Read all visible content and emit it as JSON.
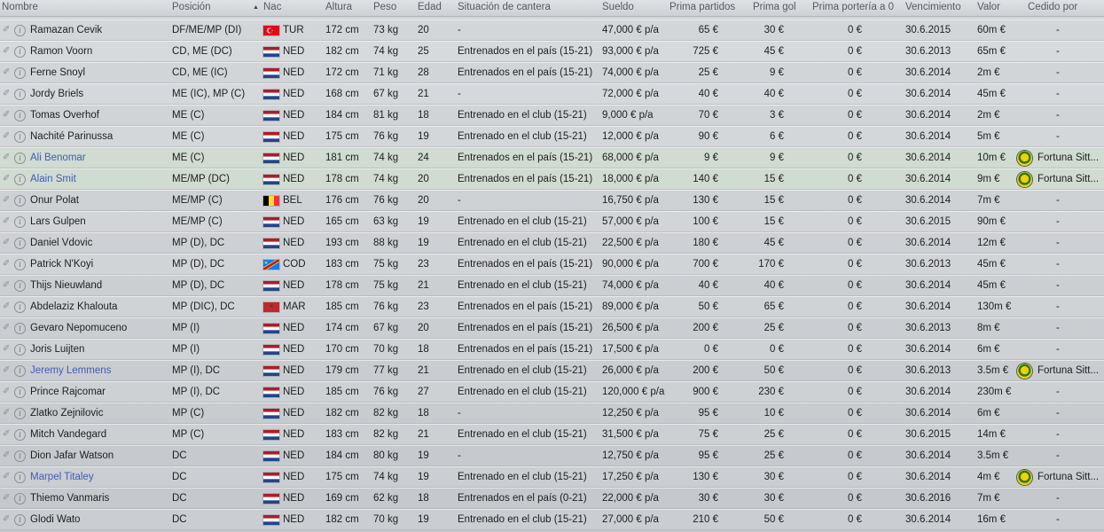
{
  "headers": {
    "nombre": "Nombre",
    "posicion": "Posición",
    "nac": "Nac",
    "altura": "Altura",
    "peso": "Peso",
    "edad": "Edad",
    "situacion": "Situación de cantera",
    "sueldo": "Sueldo",
    "prima_partidos": "Prima partidos",
    "prima_gol": "Prima gol",
    "prima_porteria": "Prima portería a 0",
    "vencimiento": "Vencimiento",
    "valor": "Valor",
    "cedido": "Cedido por",
    "sort_arrow": "▲"
  },
  "colors": {
    "link": "#3e5db6",
    "highlight_row": "#d2e1cd"
  },
  "players": [
    {
      "name": "Ramazan Cevik",
      "link": false,
      "pos": "DF/ME/MP (DI)",
      "flag": "tur",
      "nat": "TUR",
      "height": "172 cm",
      "weight": "73 kg",
      "age": "20",
      "sit": "-",
      "wage": "47,000 € p/a",
      "appb": "65 €",
      "goalb": "30 €",
      "csb": "0 €",
      "exp": "30.6.2015",
      "value": "60m €",
      "loan": "-"
    },
    {
      "name": "Ramon Voorn",
      "link": false,
      "pos": "CD, ME (DC)",
      "flag": "ned",
      "nat": "NED",
      "height": "182 cm",
      "weight": "74 kg",
      "age": "25",
      "sit": "Entrenados en el país (15-21)",
      "wage": "93,000 € p/a",
      "appb": "725 €",
      "goalb": "45 €",
      "csb": "0 €",
      "exp": "30.6.2013",
      "value": "65m €",
      "loan": "-"
    },
    {
      "name": "Ferne Snoyl",
      "link": false,
      "pos": "CD, ME (IC)",
      "flag": "ned",
      "nat": "NED",
      "height": "172 cm",
      "weight": "71 kg",
      "age": "28",
      "sit": "Entrenados en el país (15-21)",
      "wage": "74,000 € p/a",
      "appb": "25 €",
      "goalb": "9 €",
      "csb": "0 €",
      "exp": "30.6.2014",
      "value": "2m €",
      "loan": "-"
    },
    {
      "name": "Jordy Briels",
      "link": false,
      "pos": "ME (IC), MP (C)",
      "flag": "ned",
      "nat": "NED",
      "height": "168 cm",
      "weight": "67 kg",
      "age": "21",
      "sit": "-",
      "wage": "72,000 € p/a",
      "appb": "40 €",
      "goalb": "40 €",
      "csb": "0 €",
      "exp": "30.6.2014",
      "value": "45m €",
      "loan": "-"
    },
    {
      "name": "Tomas Overhof",
      "link": false,
      "pos": "ME (C)",
      "flag": "ned",
      "nat": "NED",
      "height": "184 cm",
      "weight": "81 kg",
      "age": "18",
      "sit": "Entrenado en el club (15-21)",
      "wage": "9,000 € p/a",
      "appb": "70 €",
      "goalb": "3 €",
      "csb": "0 €",
      "exp": "30.6.2014",
      "value": "2m €",
      "loan": "-"
    },
    {
      "name": "Nachité Parinussa",
      "link": false,
      "pos": "ME (C)",
      "flag": "ned",
      "nat": "NED",
      "height": "175 cm",
      "weight": "76 kg",
      "age": "19",
      "sit": "Entrenado en el club (15-21)",
      "wage": "12,000 € p/a",
      "appb": "90 €",
      "goalb": "6 €",
      "csb": "0 €",
      "exp": "30.6.2014",
      "value": "5m €",
      "loan": "-"
    },
    {
      "name": "Ali Benomar",
      "link": true,
      "pos": "ME (C)",
      "flag": "ned",
      "nat": "NED",
      "height": "181 cm",
      "weight": "74 kg",
      "age": "24",
      "sit": "Entrenados en el país (15-21)",
      "wage": "68,000 € p/a",
      "appb": "9 €",
      "goalb": "9 €",
      "csb": "0 €",
      "exp": "30.6.2014",
      "value": "10m €",
      "loan": "Fortuna Sitt..."
    },
    {
      "name": "Alain Smit",
      "link": true,
      "pos": "ME/MP (DC)",
      "flag": "ned",
      "nat": "NED",
      "height": "178 cm",
      "weight": "74 kg",
      "age": "20",
      "sit": "Entrenados en el país (15-21)",
      "wage": "18,000 € p/a",
      "appb": "140 €",
      "goalb": "15 €",
      "csb": "0 €",
      "exp": "30.6.2014",
      "value": "9m €",
      "loan": "Fortuna Sitt..."
    },
    {
      "name": "Onur Polat",
      "link": false,
      "pos": "ME/MP (C)",
      "flag": "bel",
      "nat": "BEL",
      "height": "176 cm",
      "weight": "76 kg",
      "age": "20",
      "sit": "-",
      "wage": "16,750 € p/a",
      "appb": "130 €",
      "goalb": "15 €",
      "csb": "0 €",
      "exp": "30.6.2014",
      "value": "7m €",
      "loan": "-"
    },
    {
      "name": "Lars Gulpen",
      "link": false,
      "pos": "ME/MP (C)",
      "flag": "ned",
      "nat": "NED",
      "height": "165 cm",
      "weight": "63 kg",
      "age": "19",
      "sit": "Entrenado en el club (15-21)",
      "wage": "57,000 € p/a",
      "appb": "100 €",
      "goalb": "15 €",
      "csb": "0 €",
      "exp": "30.6.2015",
      "value": "90m €",
      "loan": "-"
    },
    {
      "name": "Daniel Vdovic",
      "link": false,
      "pos": "MP (D), DC",
      "flag": "ned",
      "nat": "NED",
      "height": "193 cm",
      "weight": "88 kg",
      "age": "19",
      "sit": "Entrenado en el club (15-21)",
      "wage": "22,500 € p/a",
      "appb": "180 €",
      "goalb": "45 €",
      "csb": "0 €",
      "exp": "30.6.2014",
      "value": "12m €",
      "loan": "-"
    },
    {
      "name": "Patrick N'Koyi",
      "link": false,
      "pos": "MP (D), DC",
      "flag": "cod",
      "nat": "COD",
      "height": "183 cm",
      "weight": "75 kg",
      "age": "23",
      "sit": "Entrenados en el país (15-21)",
      "wage": "90,000 € p/a",
      "appb": "700 €",
      "goalb": "170 €",
      "csb": "0 €",
      "exp": "30.6.2013",
      "value": "45m €",
      "loan": "-"
    },
    {
      "name": "Thijs Nieuwland",
      "link": false,
      "pos": "MP (D), DC",
      "flag": "ned",
      "nat": "NED",
      "height": "178 cm",
      "weight": "75 kg",
      "age": "21",
      "sit": "Entrenado en el club (15-21)",
      "wage": "74,000 € p/a",
      "appb": "40 €",
      "goalb": "40 €",
      "csb": "0 €",
      "exp": "30.6.2014",
      "value": "45m €",
      "loan": "-"
    },
    {
      "name": "Abdelaziz Khalouta",
      "link": false,
      "pos": "MP (DIC), DC",
      "flag": "mar",
      "nat": "MAR",
      "height": "185 cm",
      "weight": "76 kg",
      "age": "23",
      "sit": "Entrenados en el país (15-21)",
      "wage": "89,000 € p/a",
      "appb": "50 €",
      "goalb": "65 €",
      "csb": "0 €",
      "exp": "30.6.2014",
      "value": "130m €",
      "loan": "-"
    },
    {
      "name": "Gevaro Nepomuceno",
      "link": false,
      "pos": "MP (I)",
      "flag": "ned",
      "nat": "NED",
      "height": "174 cm",
      "weight": "67 kg",
      "age": "20",
      "sit": "Entrenados en el país (15-21)",
      "wage": "26,500 € p/a",
      "appb": "200 €",
      "goalb": "25 €",
      "csb": "0 €",
      "exp": "30.6.2013",
      "value": "8m €",
      "loan": "-"
    },
    {
      "name": "Joris Luijten",
      "link": false,
      "pos": "MP (I)",
      "flag": "ned",
      "nat": "NED",
      "height": "170 cm",
      "weight": "70 kg",
      "age": "18",
      "sit": "Entrenados en el país (15-21)",
      "wage": "17,500 € p/a",
      "appb": "0 €",
      "goalb": "0 €",
      "csb": "0 €",
      "exp": "30.6.2014",
      "value": "6m €",
      "loan": "-"
    },
    {
      "name": "Jeremy Lemmens",
      "link": true,
      "pos": "MP (I), DC",
      "flag": "ned",
      "nat": "NED",
      "height": "179 cm",
      "weight": "77 kg",
      "age": "21",
      "sit": "Entrenado en el club (15-21)",
      "wage": "26,000 € p/a",
      "appb": "200 €",
      "goalb": "50 €",
      "csb": "0 €",
      "exp": "30.6.2013",
      "value": "3.5m €",
      "loan": "Fortuna Sitt..."
    },
    {
      "name": "Prince Rajcomar",
      "link": false,
      "pos": "MP (I), DC",
      "flag": "ned",
      "nat": "NED",
      "height": "185 cm",
      "weight": "76 kg",
      "age": "27",
      "sit": "Entrenado en el club (15-21)",
      "wage": "120,000 € p/a",
      "appb": "900 €",
      "goalb": "230 €",
      "csb": "0 €",
      "exp": "30.6.2014",
      "value": "230m €",
      "loan": "-"
    },
    {
      "name": "Zlatko Zejnilovic",
      "link": false,
      "pos": "MP (C)",
      "flag": "ned",
      "nat": "NED",
      "height": "182 cm",
      "weight": "82 kg",
      "age": "18",
      "sit": "-",
      "wage": "12,250 € p/a",
      "appb": "95 €",
      "goalb": "10 €",
      "csb": "0 €",
      "exp": "30.6.2014",
      "value": "6m €",
      "loan": "-"
    },
    {
      "name": "Mitch Vandegard",
      "link": false,
      "pos": "MP (C)",
      "flag": "ned",
      "nat": "NED",
      "height": "183 cm",
      "weight": "82 kg",
      "age": "21",
      "sit": "Entrenado en el club (15-21)",
      "wage": "31,500 € p/a",
      "appb": "75 €",
      "goalb": "25 €",
      "csb": "0 €",
      "exp": "30.6.2015",
      "value": "14m €",
      "loan": "-"
    },
    {
      "name": "Dion Jafar Watson",
      "link": false,
      "pos": "DC",
      "flag": "ned",
      "nat": "NED",
      "height": "184 cm",
      "weight": "80 kg",
      "age": "19",
      "sit": "-",
      "wage": "12,750 € p/a",
      "appb": "95 €",
      "goalb": "25 €",
      "csb": "0 €",
      "exp": "30.6.2014",
      "value": "3.5m €",
      "loan": "-"
    },
    {
      "name": "Marpel Titaley",
      "link": true,
      "pos": "DC",
      "flag": "ned",
      "nat": "NED",
      "height": "175 cm",
      "weight": "74 kg",
      "age": "19",
      "sit": "Entrenado en el club (15-21)",
      "wage": "17,250 € p/a",
      "appb": "130 €",
      "goalb": "30 €",
      "csb": "0 €",
      "exp": "30.6.2014",
      "value": "4m €",
      "loan": "Fortuna Sitt..."
    },
    {
      "name": "Thiemo Vanmaris",
      "link": false,
      "pos": "DC",
      "flag": "ned",
      "nat": "NED",
      "height": "169 cm",
      "weight": "62 kg",
      "age": "18",
      "sit": "Entrenados en el país (0-21)",
      "wage": "22,000 € p/a",
      "appb": "30 €",
      "goalb": "30 €",
      "csb": "0 €",
      "exp": "30.6.2016",
      "value": "7m €",
      "loan": "-"
    },
    {
      "name": "Glodi Wato",
      "link": false,
      "pos": "DC",
      "flag": "ned",
      "nat": "NED",
      "height": "182 cm",
      "weight": "70 kg",
      "age": "19",
      "sit": "Entrenado en el club (15-21)",
      "wage": "27,000 € p/a",
      "appb": "210 €",
      "goalb": "50 €",
      "csb": "0 €",
      "exp": "30.6.2014",
      "value": "16m €",
      "loan": "-"
    }
  ]
}
